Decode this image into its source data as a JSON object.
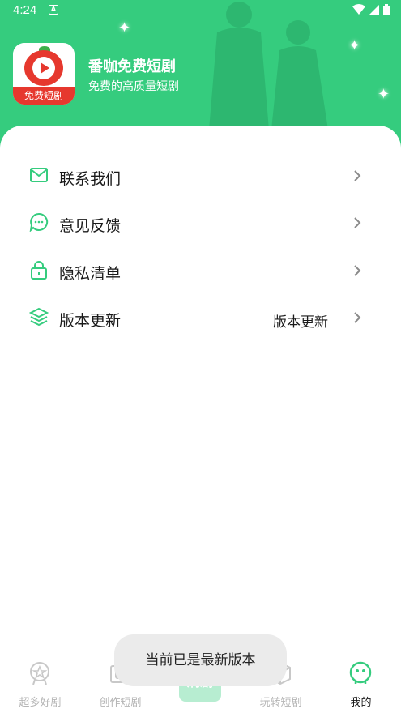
{
  "status_bar": {
    "time": "4:24",
    "notification_glyph": "A"
  },
  "app": {
    "logo_text": "免费短剧",
    "name": "番咖免费短剧",
    "slogan": "免费的高质量短剧"
  },
  "menu": [
    {
      "icon": "mail-icon",
      "label": "联系我们",
      "value": ""
    },
    {
      "icon": "chat-bubble-icon",
      "label": "意见反馈",
      "value": ""
    },
    {
      "icon": "lock-icon",
      "label": "隐私清单",
      "value": ""
    },
    {
      "icon": "layers-icon",
      "label": "版本更新",
      "value": "版本更新"
    }
  ],
  "toast": {
    "message": "当前已是最新版本"
  },
  "tabbar": {
    "tabs": [
      {
        "icon": "medal-star-icon",
        "label": "超多好剧",
        "active": false
      },
      {
        "icon": "book-icon",
        "label": "创作短剧",
        "active": false
      },
      {
        "icon": "center-action-icon",
        "label": "刷剧",
        "active": false
      },
      {
        "icon": "cube-icon",
        "label": "玩转短剧",
        "active": false
      },
      {
        "icon": "smiley-face-icon",
        "label": "我的",
        "active": true
      }
    ]
  },
  "colors": {
    "brand_green": "#35cc7e",
    "logo_red": "#e6382e",
    "inactive_tab": "#b5b5b5"
  }
}
